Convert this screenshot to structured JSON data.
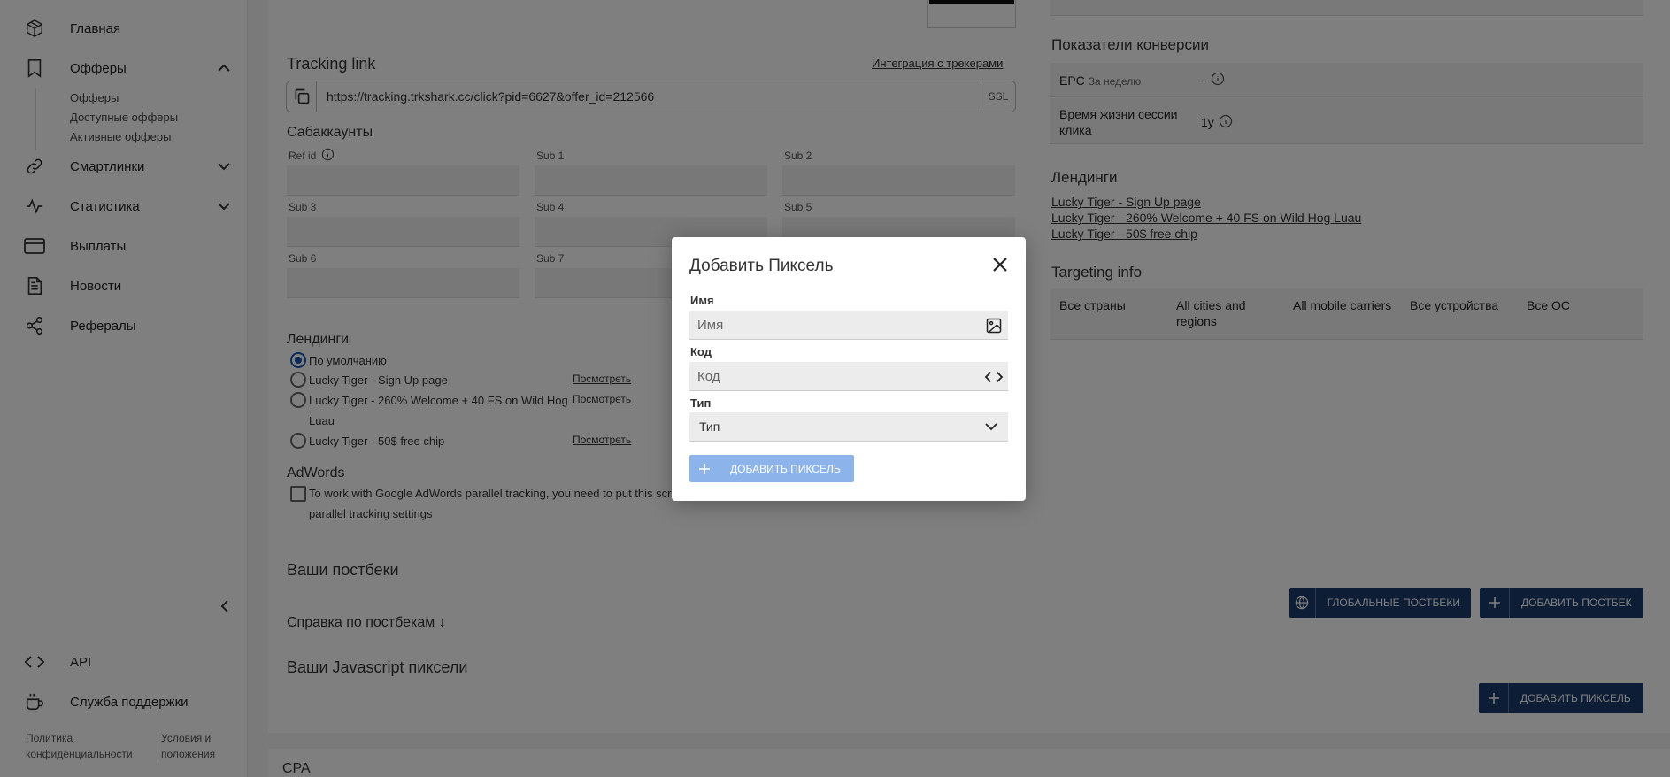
{
  "sidebar": {
    "items": [
      {
        "label": "Главная"
      },
      {
        "label": "Офферы"
      },
      {
        "label": "Смартлинки"
      },
      {
        "label": "Статистика"
      },
      {
        "label": "Выплаты"
      },
      {
        "label": "Новости"
      },
      {
        "label": "Рефералы"
      }
    ],
    "offers_sub": [
      "Офферы",
      "Доступные офферы",
      "Активные офферы"
    ],
    "bottom": [
      {
        "label": "API"
      },
      {
        "label": "Служба поддержки"
      }
    ],
    "footer": {
      "privacy": "Политика конфиденциальности",
      "terms": "Условия и положения"
    }
  },
  "main": {
    "tracking_link": {
      "title": "Tracking link",
      "integration_link": "Интеграция с трекерами",
      "url": "https://tracking.trkshark.cc/click?pid=6627&offer_id=212566",
      "ssl": "SSL"
    },
    "subaccounts": {
      "title": "Сабаккаунты",
      "fields": [
        "Ref id",
        "Sub 1",
        "Sub 2",
        "Sub 3",
        "Sub 4",
        "Sub 5",
        "Sub 6",
        "Sub 7"
      ]
    },
    "landings": {
      "title": "Лендинги",
      "options": [
        {
          "label": "По умолчанию",
          "view": ""
        },
        {
          "label": "Lucky Tiger - Sign Up page",
          "view": "Посмотреть"
        },
        {
          "label": "Lucky Tiger - 260% Welcome + 40 FS on Wild Hog",
          "label2": "Luau",
          "view": "Посмотреть"
        },
        {
          "label": "Lucky Tiger - 50$ free chip",
          "view": "Посмотреть"
        }
      ]
    },
    "adwords": {
      "title": "AdWords",
      "text1": "To work with Google AdWords parallel tracking, you need to put this script",
      "text2": "parallel tracking settings"
    },
    "postbacks": {
      "title": "Ваши постбеки",
      "help": "Справка по постбекам",
      "global_btn": "Глобальные постбеки",
      "add_btn": "Добавить постбек"
    },
    "js_pixels": {
      "title": "Ваши Javascript пиксели",
      "add_btn": "Добавить пиксель"
    },
    "cpa": {
      "title": "CPA"
    }
  },
  "right": {
    "conversion": {
      "title": "Показатели конверсии",
      "epc_label": "EPC",
      "epc_sub": "За неделю",
      "epc_value": "-",
      "session_label1": "Время жизни сессии",
      "session_label2": "клика",
      "session_value": "1y"
    },
    "landings": {
      "title": "Лендинги",
      "links": [
        "Lucky Tiger - Sign Up page",
        "Lucky Tiger - 260% Welcome + 40 FS on Wild Hog Luau",
        "Lucky Tiger - 50$ free chip"
      ]
    },
    "targeting": {
      "title": "Targeting info",
      "cols": [
        "Все страны",
        "All cities and",
        "All mobile carriers",
        "Все устройства",
        "Все ОС"
      ],
      "cols2": [
        "",
        "regions",
        "",
        "",
        ""
      ]
    }
  },
  "modal": {
    "title": "Добавить Пиксель",
    "name_label": "Имя",
    "name_placeholder": "Имя",
    "code_label": "Код",
    "code_placeholder": "Код",
    "type_label": "Тип",
    "type_value": "Тип",
    "submit": "Добавить пиксель"
  },
  "colors": {
    "primary": "#1a3a6c",
    "submit_disabled": "#8db4ea",
    "radio_active": "#1a56b0"
  }
}
